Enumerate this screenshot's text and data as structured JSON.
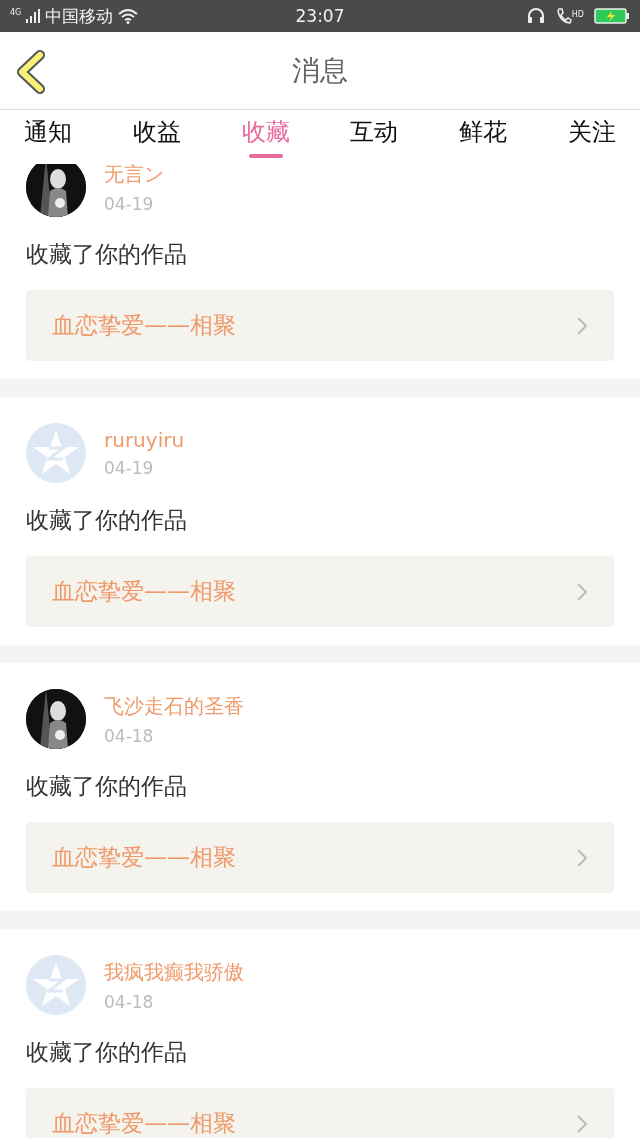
{
  "status_bar": {
    "network": "4G",
    "carrier": "中国移动",
    "time": "23:07",
    "call_badge": "HD"
  },
  "header": {
    "title": "消息"
  },
  "tabs": [
    {
      "label": "通知",
      "selected": false
    },
    {
      "label": "收益",
      "selected": false
    },
    {
      "label": "收藏",
      "selected": true
    },
    {
      "label": "互动",
      "selected": false
    },
    {
      "label": "鲜花",
      "selected": false
    },
    {
      "label": "关注",
      "selected": false
    }
  ],
  "messages": [
    {
      "name": "无言ン",
      "date": "04-19",
      "text": "收藏了你的作品",
      "work": "血恋挚爱——相聚"
    },
    {
      "avatar": {
        "kind": "default"
      },
      "name": "ruruyiru",
      "date": "04-19",
      "text": "收藏了你的作品",
      "work": "血恋挚爱——相聚"
    },
    {
      "name": "飞沙走石的圣香",
      "date": "04-18",
      "text": "收藏了你的作品",
      "work": "血恋挚爱——相聚"
    },
    {
      "avatar": {
        "kind": "default"
      },
      "name": "我疯我癫我骄傲",
      "date": "04-18",
      "text": "收藏了你的作品",
      "work": "血恋挚爱——相聚"
    }
  ]
}
